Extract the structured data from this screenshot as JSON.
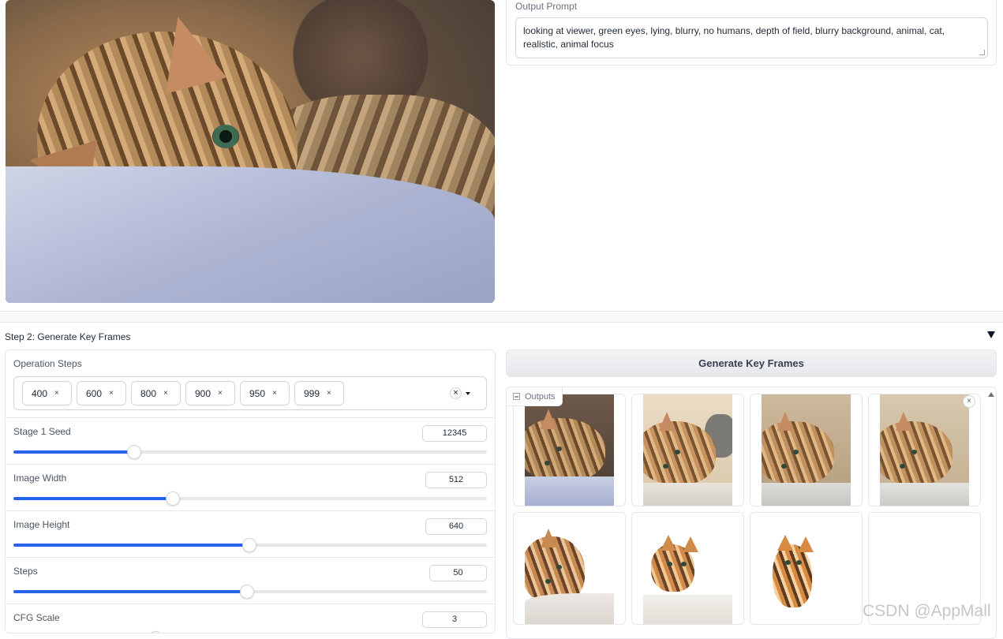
{
  "output_prompt": {
    "label": "Output Prompt",
    "text": "looking at viewer, green eyes, lying, blurry, no humans, depth of field, blurry background, animal, cat, realistic, animal focus"
  },
  "step2": {
    "title": "Step 2: Generate Key Frames"
  },
  "operation_steps": {
    "label": "Operation Steps",
    "tokens": [
      "400",
      "600",
      "800",
      "900",
      "950",
      "999"
    ],
    "remove_glyph": "×",
    "clear_glyph": "×"
  },
  "sliders": [
    {
      "label": "Stage 1 Seed",
      "value": "12345",
      "fraction": 0.255
    },
    {
      "label": "Image Width",
      "value": "512",
      "fraction": 0.337
    },
    {
      "label": "Image Height",
      "value": "640",
      "fraction": 0.498
    },
    {
      "label": "Steps",
      "value": "50",
      "fraction": 0.494
    },
    {
      "label": "CFG Scale",
      "value": "3",
      "fraction": 0.3
    }
  ],
  "generate_button": {
    "label": "Generate Key Frames"
  },
  "gallery": {
    "label": "Outputs",
    "close_glyph": "×",
    "item_count": 8
  },
  "watermark": "CSDN @AppMall",
  "colors": {
    "accent": "#2563eb",
    "border": "#e5e7eb"
  }
}
